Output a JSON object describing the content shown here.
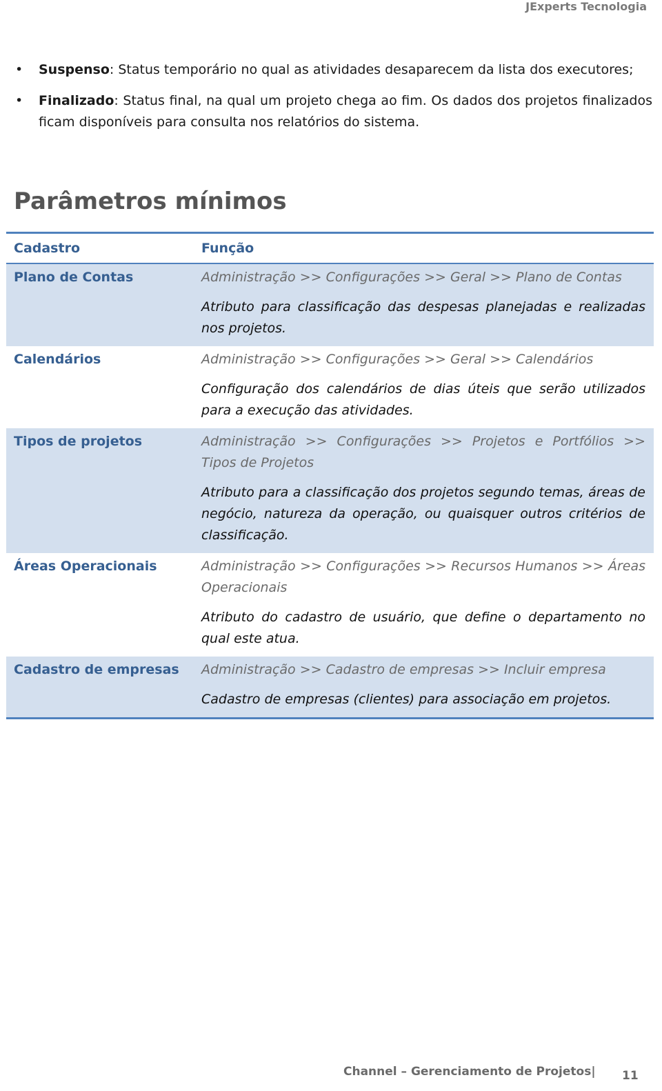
{
  "header": {
    "company": "JExperts Tecnologia"
  },
  "bullets": [
    {
      "term": "Suspenso",
      "text": ": Status temporário no qual as atividades desaparecem da lista dos executores;"
    },
    {
      "term": "Finalizado",
      "text": ": Status final, na qual um projeto chega ao fim. Os dados dos projetos finalizados ficam disponíveis para consulta nos relatórios do sistema."
    }
  ],
  "section": {
    "title": "Parâmetros mínimos"
  },
  "table": {
    "headers": [
      "Cadastro",
      "Função"
    ],
    "rows": [
      {
        "cadastro": "Plano de Contas",
        "path": "Administração >> Configurações >> Geral >> Plano de Contas",
        "desc": "Atributo para classificação das despesas planejadas e realizadas nos projetos."
      },
      {
        "cadastro": "Calendários",
        "path": "Administração >> Configurações >> Geral >> Calendários",
        "desc": "Configuração dos calendários de dias úteis que serão utilizados para a execução das atividades."
      },
      {
        "cadastro": "Tipos de projetos",
        "path": "Administração >> Configurações >> Projetos e Portfólios >> Tipos de Projetos",
        "desc": "Atributo para a classificação dos projetos segundo temas, áreas de negócio, natureza da operação, ou quaisquer outros critérios de classificação."
      },
      {
        "cadastro": "Áreas Operacionais",
        "path": "Administração >> Configurações >> Recursos Humanos >> Áreas Operacionais",
        "desc": "Atributo do cadastro de usuário, que define o departamento no qual este atua."
      },
      {
        "cadastro": "Cadastro de empresas",
        "path": "Administração >> Cadastro de empresas >> Incluir empresa",
        "desc": "Cadastro de empresas (clientes) para associação em projetos."
      }
    ]
  },
  "footer": {
    "text": "Channel – Gerenciamento de Projetos|",
    "page": "11"
  }
}
